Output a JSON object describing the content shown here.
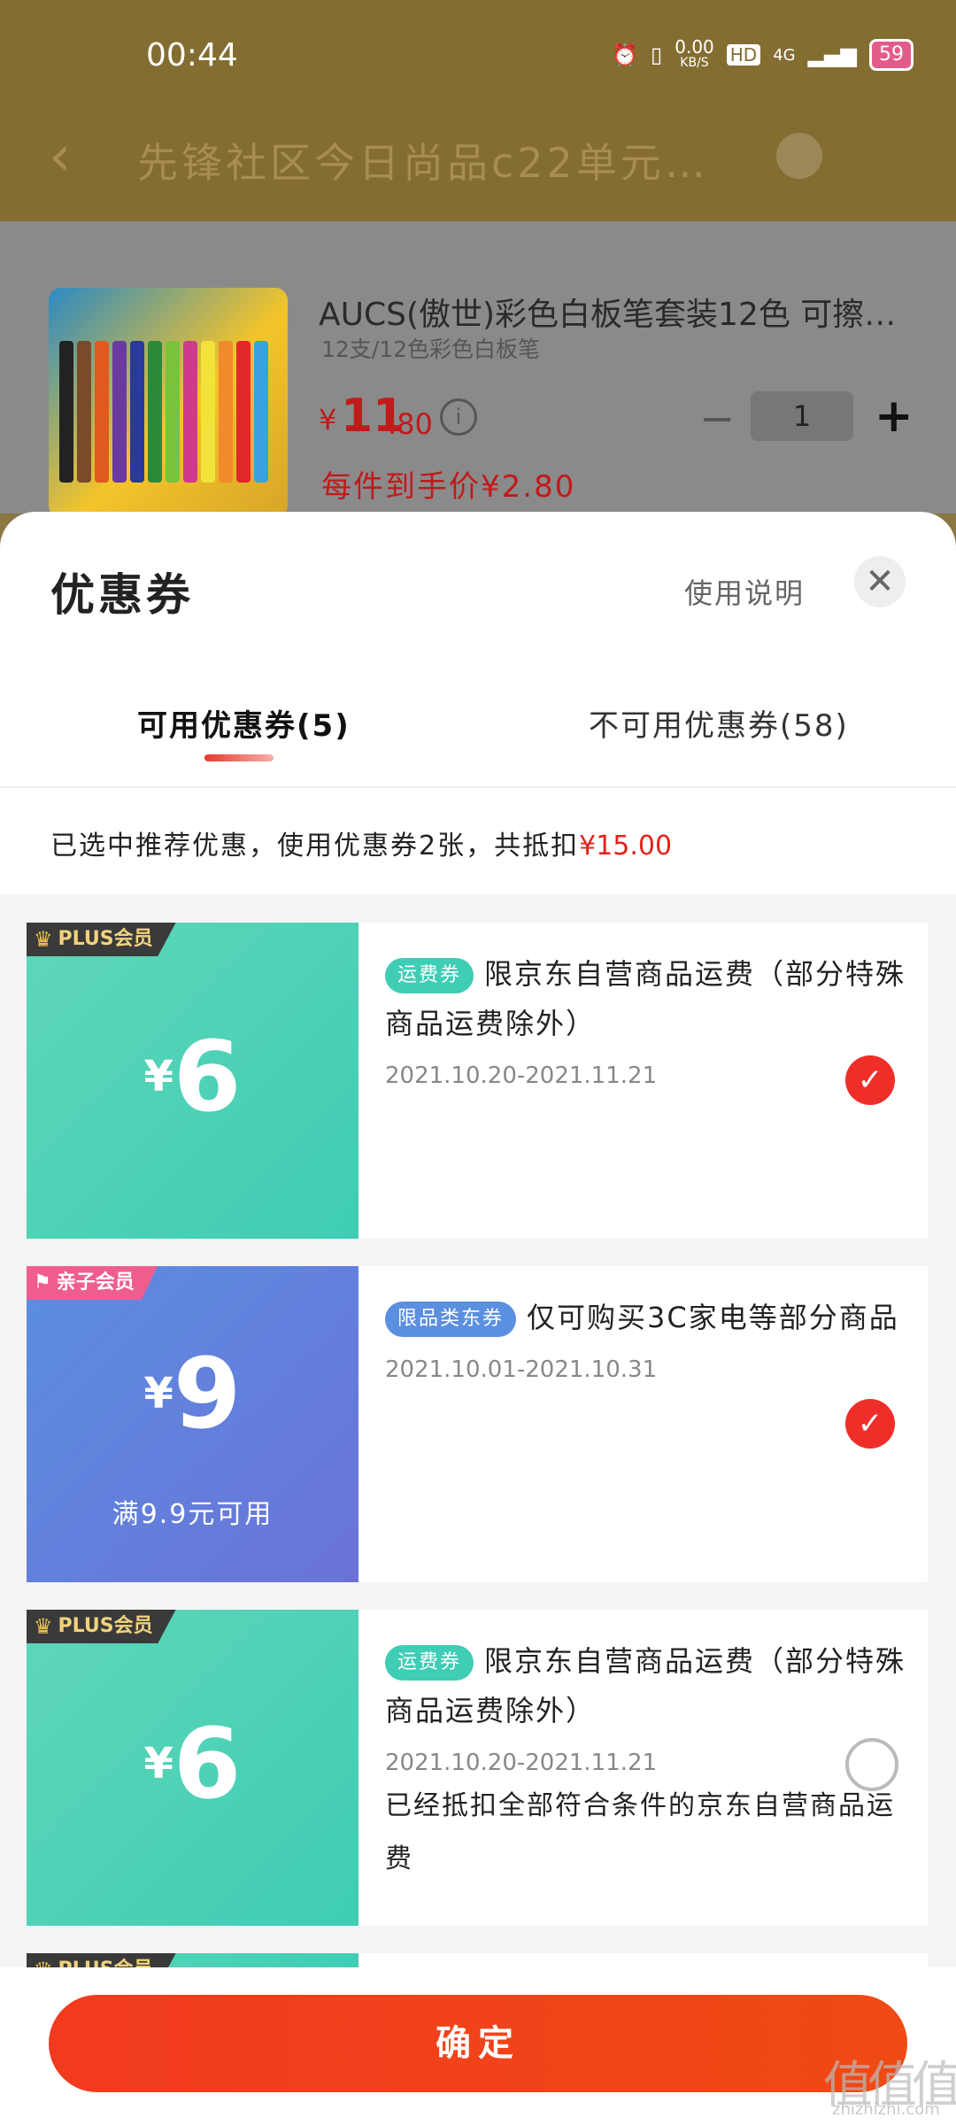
{
  "status_bar": {
    "time": "00:44",
    "net_speed": "0.00",
    "net_unit": "KB/S",
    "hd": "HD",
    "network": "4G",
    "battery": "59"
  },
  "header": {
    "title": "先锋社区今日尚品c22单元…"
  },
  "product": {
    "name": "AUCS(傲世)彩色白板笔套装12色 可擦…",
    "spec": "12支/12色彩色白板笔",
    "price_symbol": "¥",
    "price_int": "11",
    "price_dec": ".80",
    "quantity": "1",
    "per_price": "每件到手价¥2.80"
  },
  "sheet": {
    "title": "优惠券",
    "usage_link": "使用说明",
    "tabs": [
      {
        "label": "可用优惠券(5)"
      },
      {
        "label": "不可用优惠券(58)"
      }
    ],
    "summary_prefix": "已选中推荐优惠，使用优惠券2张，共抵扣",
    "summary_amount": "¥15.00"
  },
  "coupons": [
    {
      "badge": "PLUS会员",
      "symbol": "¥",
      "amount": "6",
      "condition": "",
      "tag": "运费券",
      "desc": "限京东自营商品运费（部分特殊商品运费除外）",
      "date": "2021.10.20-2021.11.21",
      "note": "",
      "selected": true
    },
    {
      "badge": "亲子会员",
      "symbol": "¥",
      "amount": "9",
      "condition": "满9.9元可用",
      "tag": "限品类东券",
      "desc": "仅可购买3C家电等部分商品",
      "date": "2021.10.01-2021.10.31",
      "note": "",
      "selected": true
    },
    {
      "badge": "PLUS会员",
      "symbol": "¥",
      "amount": "6",
      "condition": "",
      "tag": "运费券",
      "desc": "限京东自营商品运费（部分特殊商品运费除外）",
      "date": "2021.10.20-2021.11.21",
      "note": "已经抵扣全部符合条件的京东自营商品运费",
      "selected": false
    },
    {
      "badge": "PLUS会员"
    }
  ],
  "confirm_label": "确定",
  "watermark": {
    "main": "值值值",
    "sub": "zhizhizhi.com"
  },
  "colors": {
    "accent_red": "#e2231a",
    "coupon_green": "#3fcdb6",
    "coupon_blue": "#5b8fe0"
  }
}
